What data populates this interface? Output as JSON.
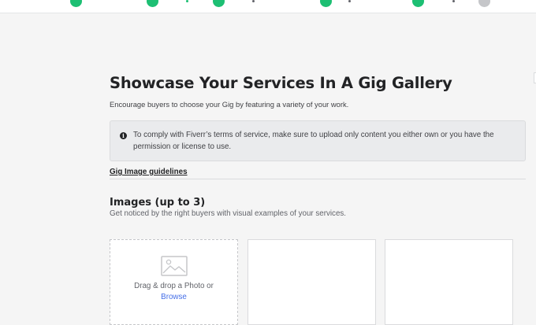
{
  "page": {
    "title": "Showcase Your Services In A Gig Gallery",
    "subtitle": "Encourage buyers to choose your Gig by featuring a variety of your work."
  },
  "notice": {
    "icon": "info-icon",
    "text": "To comply with Fiverr’s terms of service, make sure to upload only content you either own or you have the permission or license to use."
  },
  "guidelines": {
    "link_text": "Gig Image guidelines"
  },
  "images_section": {
    "title": "Images (up to 3)",
    "description": "Get noticed by the right buyers with visual examples of your services.",
    "upload_slots": [
      {
        "drop_text": "Drag & drop a Photo or",
        "browse_label": "Browse",
        "icon": "photo-icon"
      }
    ]
  },
  "progress": {
    "completed_steps": 6,
    "total_steps": 7
  },
  "colors": {
    "accent": "#1dbf73",
    "link": "#446ee7",
    "notice_bg": "#eaebed"
  }
}
